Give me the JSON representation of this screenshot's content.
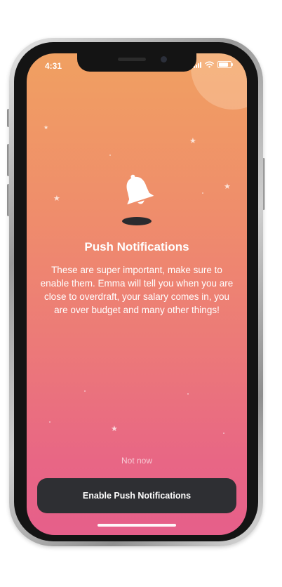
{
  "status_bar": {
    "time": "4:31",
    "icons": [
      "signal-icon",
      "wifi-icon",
      "battery-icon"
    ]
  },
  "screen": {
    "icon": "bell-icon",
    "title": "Push Notifications",
    "body": "These are super important, make sure to enable them. Emma will tell you when you are close to overdraft, your salary comes in, you are over budget and many other things!",
    "secondary_action": "Not now",
    "primary_action": "Enable Push Notifications"
  },
  "colors": {
    "gradient_top": "#f0a061",
    "gradient_bottom": "#e65f8a",
    "button_background": "#2e2f33",
    "text": "#ffffff"
  }
}
